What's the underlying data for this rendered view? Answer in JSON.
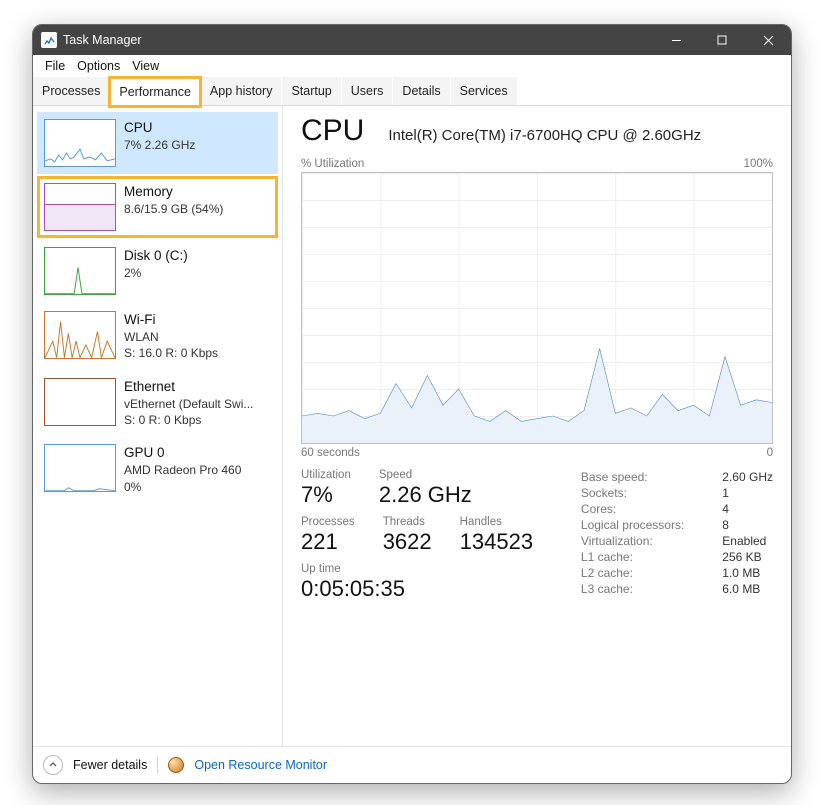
{
  "window": {
    "title": "Task Manager"
  },
  "menu": {
    "file": "File",
    "options": "Options",
    "view": "View"
  },
  "tabs": {
    "processes": "Processes",
    "performance": "Performance",
    "app_history": "App history",
    "startup": "Startup",
    "users": "Users",
    "details": "Details",
    "services": "Services"
  },
  "sidebar": {
    "cpu": {
      "title": "CPU",
      "sub": "7%  2.26 GHz"
    },
    "memory": {
      "title": "Memory",
      "sub": "8.6/15.9 GB (54%)"
    },
    "disk": {
      "title": "Disk 0 (C:)",
      "sub": "2%"
    },
    "wifi": {
      "title": "Wi-Fi",
      "sub1": "WLAN",
      "sub2": "S: 16.0 R: 0 Kbps"
    },
    "eth": {
      "title": "Ethernet",
      "sub1": "vEthernet (Default Swi...",
      "sub2": "S: 0 R: 0 Kbps"
    },
    "gpu": {
      "title": "GPU 0",
      "sub1": "AMD Radeon Pro 460",
      "sub2": "0%"
    }
  },
  "panel": {
    "heading": "CPU",
    "model": "Intel(R) Core(TM) i7-6700HQ CPU @ 2.60GHz",
    "ylabel_left": "% Utilization",
    "ylabel_right": "100%",
    "xlabel_left": "60 seconds",
    "xlabel_right": "0",
    "stats": {
      "utilization_label": "Utilization",
      "utilization": "7%",
      "speed_label": "Speed",
      "speed": "2.26 GHz",
      "processes_label": "Processes",
      "processes": "221",
      "threads_label": "Threads",
      "threads": "3622",
      "handles_label": "Handles",
      "handles": "134523",
      "uptime_label": "Up time",
      "uptime": "0:05:05:35"
    },
    "right": {
      "base_speed_label": "Base speed:",
      "base_speed": "2.60 GHz",
      "sockets_label": "Sockets:",
      "sockets": "1",
      "cores_label": "Cores:",
      "cores": "4",
      "lp_label": "Logical processors:",
      "lp": "8",
      "virt_label": "Virtualization:",
      "virt": "Enabled",
      "l1_label": "L1 cache:",
      "l1": "256 KB",
      "l2_label": "L2 cache:",
      "l2": "1.0 MB",
      "l3_label": "L3 cache:",
      "l3": "6.0 MB"
    }
  },
  "footer": {
    "fewer": "Fewer details",
    "resource_monitor": "Open Resource Monitor"
  },
  "chart_data": {
    "type": "line",
    "title": "CPU % Utilization",
    "xlabel": "seconds ago",
    "ylabel": "% Utilization",
    "ylim": [
      0,
      100
    ],
    "x": [
      60,
      58,
      56,
      54,
      52,
      50,
      48,
      46,
      44,
      42,
      40,
      38,
      36,
      34,
      32,
      30,
      28,
      26,
      24,
      22,
      20,
      18,
      16,
      14,
      12,
      10,
      8,
      6,
      4,
      2,
      0
    ],
    "values": [
      10,
      11,
      10,
      12,
      9,
      11,
      22,
      13,
      25,
      14,
      20,
      10,
      8,
      12,
      8,
      9,
      10,
      8,
      12,
      35,
      11,
      13,
      10,
      18,
      12,
      14,
      10,
      32,
      14,
      16,
      15
    ]
  }
}
